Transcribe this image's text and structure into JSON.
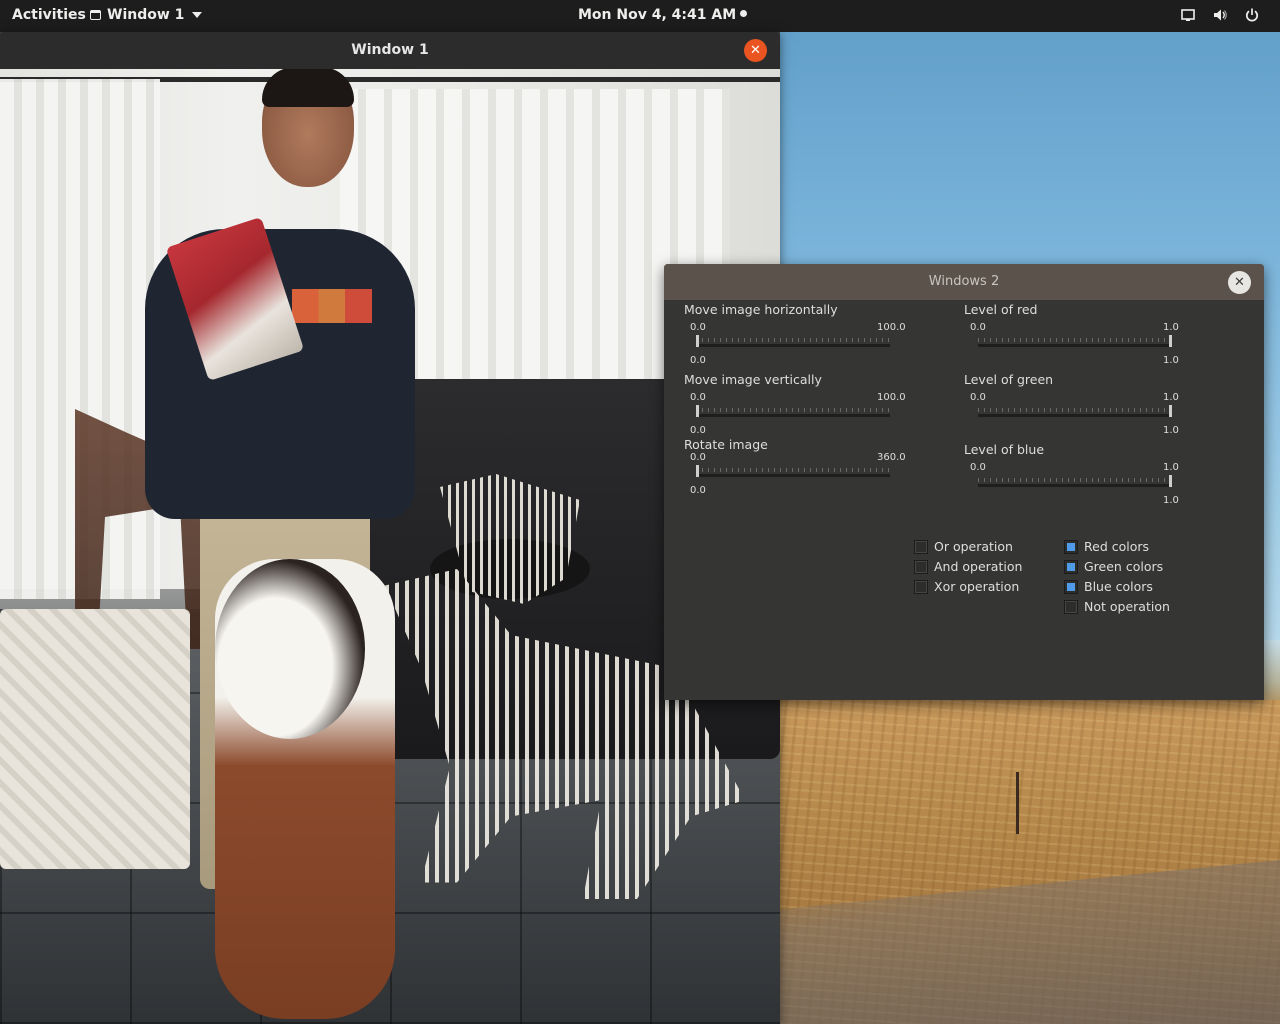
{
  "topbar": {
    "activities": "Activities",
    "app_menu": "Window 1",
    "clock": "Mon Nov  4,  4:41 AM",
    "tray_icons": [
      "screen-icon",
      "volume-icon",
      "power-icon"
    ]
  },
  "window1": {
    "title": "Window 1",
    "close_glyph": "✕",
    "content": "photo"
  },
  "window2": {
    "title": "Windows 2",
    "close_glyph": "✕",
    "sliders": [
      {
        "label": "Move image horizontally",
        "min": "0.0",
        "max": "100.0",
        "value": "0.0",
        "fraction": 0.0
      },
      {
        "label": "Move image vertically",
        "min": "0.0",
        "max": "100.0",
        "value": "0.0",
        "fraction": 0.0
      },
      {
        "label": "Rotate image",
        "min": "0.0",
        "max": "360.0",
        "value": "0.0",
        "fraction": 0.0
      },
      {
        "label": "Level of red",
        "min": "0.0",
        "max": "1.0",
        "value": "1.0",
        "fraction": 1.0
      },
      {
        "label": "Level of green",
        "min": "0.0",
        "max": "1.0",
        "value": "1.0",
        "fraction": 1.0
      },
      {
        "label": "Level of blue",
        "min": "0.0",
        "max": "1.0",
        "value": "1.0",
        "fraction": 1.0
      }
    ],
    "checkboxes": [
      {
        "label": "Or operation",
        "checked": false
      },
      {
        "label": "And operation",
        "checked": false
      },
      {
        "label": "Xor operation",
        "checked": false
      },
      {
        "label": "Red colors",
        "checked": true
      },
      {
        "label": "Green colors",
        "checked": true
      },
      {
        "label": "Blue colors",
        "checked": true
      },
      {
        "label": "Not operation",
        "checked": false
      }
    ]
  },
  "colors": {
    "accent_orange": "#e95420",
    "checkbox_blue": "#4f9be8",
    "panel_bg": "#353533",
    "topbar_bg": "#1d1d1d"
  }
}
